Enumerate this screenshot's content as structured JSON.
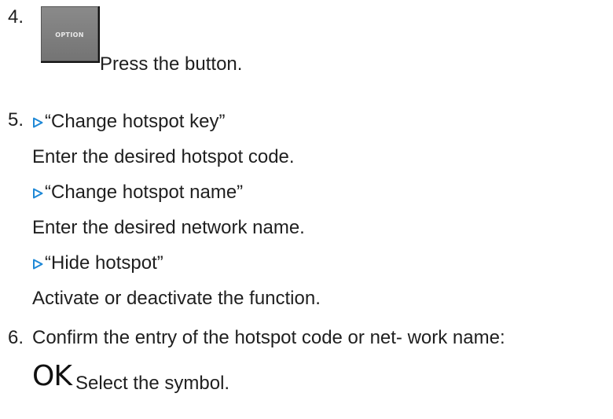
{
  "steps": [
    {
      "number": "4.",
      "button_label": "OPTION",
      "text": "Press the button."
    },
    {
      "number": "5.",
      "items": [
        {
          "title": "“Change hotspot key”",
          "text": "Enter the desired hotspot code."
        },
        {
          "title": "“Change hotspot name”",
          "text": "Enter the desired network name."
        },
        {
          "title": "“Hide hotspot”",
          "text": "Activate or deactivate the function."
        }
      ]
    },
    {
      "number": "6.",
      "text": "Confirm the entry of the hotspot code or net- work name:",
      "symbol": "OK",
      "symbol_text": "Select the symbol."
    }
  ],
  "icons": {
    "item_marker": "triangle-right-icon",
    "marker_color": "#1e88d6"
  }
}
